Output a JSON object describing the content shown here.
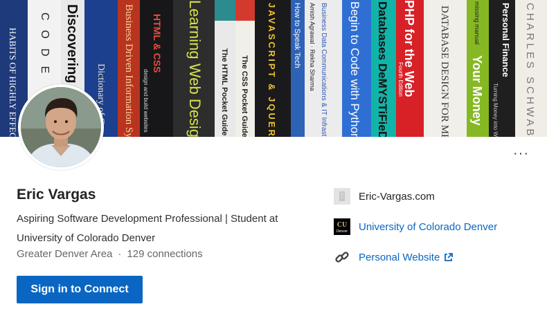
{
  "banner": {
    "book_titles": [
      "HABITS OF HIGHLY EFFECTIVE PEOPLE",
      "CODE",
      "Discovering Computers",
      "Dictionary of Computer",
      "Business Driven Information Systems",
      "HTML & CSS",
      "Learning Web Design",
      "The HTML Pocket Guide",
      "The CSS Pocket Guide",
      "JAVASCRIPT & JQUERY",
      "How to Speak Tech",
      "Business Data Communications & IT Infrastructure",
      "Begin to Code with Python",
      "Databases DeMYSTiFieD",
      "PHP for the Web",
      "DATABASE DESIGN FOR MERE MORTALS",
      "Your Money",
      "Personal Finance",
      "CHARLES SCHWAB INVESTED"
    ],
    "book_subtitles": {
      "html_css": "design and build websites",
      "php": "Fourth Edition",
      "your_money": "missing manual",
      "personal_finance": "Turning Money into Wealth",
      "data_comm_authors": "Amish Agrawal · Rekha Sharma"
    }
  },
  "profile": {
    "name": "Eric Vargas",
    "headline": "Aspiring Software Development Professional | Student at University of Colorado Denver",
    "location": "Greater Denver Area",
    "separator": "·",
    "connections": "129 connections",
    "connect_button": "Sign in to Connect",
    "more_label": "···"
  },
  "links": [
    {
      "text": "Eric-Vargas.com",
      "icon": "company-placeholder-icon"
    },
    {
      "text": "University of Colorado Denver",
      "icon": "cu-denver-logo",
      "logo_text": "Denver"
    },
    {
      "text": "Personal Website",
      "icon": "link-icon",
      "external": "external-link-icon"
    }
  ],
  "colors": {
    "accent": "#0a66c2",
    "button_text": "#ffffff",
    "name_text": "#222222",
    "muted_text": "#666666"
  }
}
